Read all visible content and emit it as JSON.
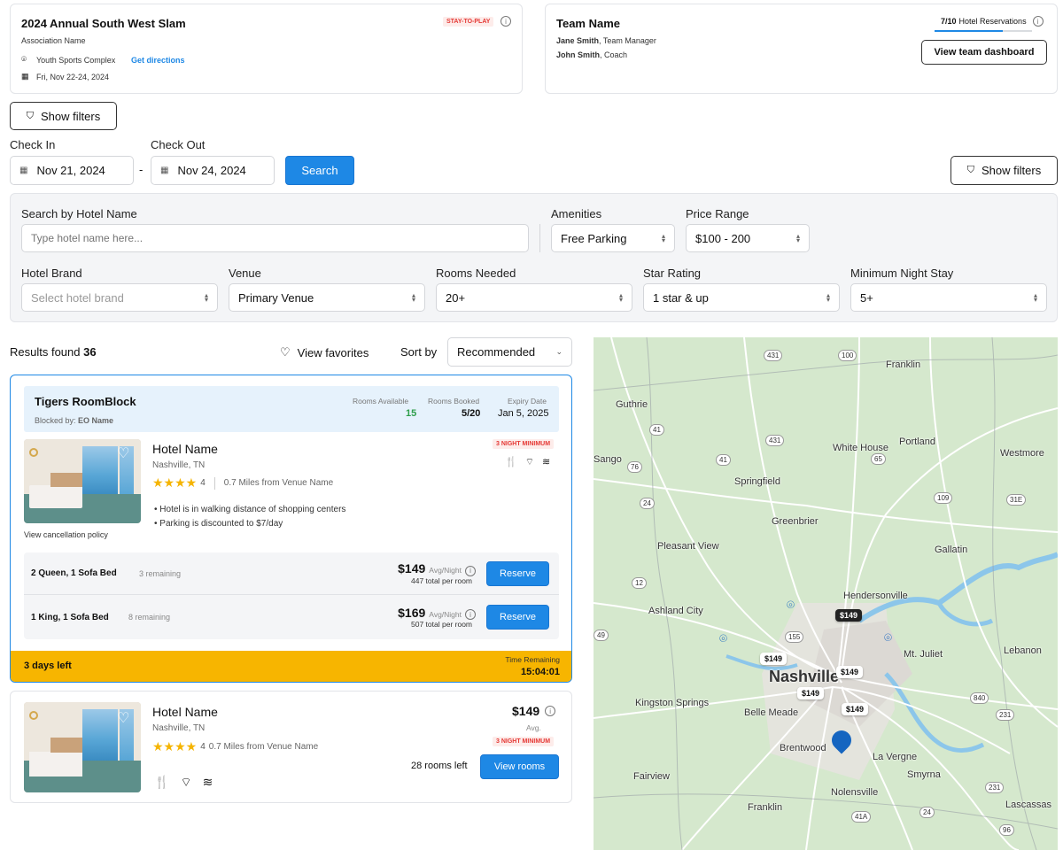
{
  "event": {
    "title": "2024 Annual South West Slam",
    "association": "Association Name",
    "badge": "STAY-TO-PLAY",
    "venue": "Youth Sports Complex",
    "directions": "Get directions",
    "dates": "Fri, Nov 22-24, 2024"
  },
  "team": {
    "title": "Team Name",
    "manager_name": "Jane Smith",
    "manager_role": ", Team Manager",
    "coach_name": "John Smith",
    "coach_role": ", Coach",
    "reservations_count": "7/10",
    "reservations_label": "Hotel Reservations",
    "reservations_progress": 0.7,
    "dashboard_button": "View team dashboard"
  },
  "show_filters": "Show filters",
  "dates": {
    "checkin_label": "Check In",
    "checkin_value": "Nov 21, 2024",
    "checkout_label": "Check Out",
    "checkout_value": "Nov 24, 2024",
    "separator": "-",
    "search": "Search"
  },
  "filters": {
    "hotel_name_label": "Search by Hotel Name",
    "hotel_name_placeholder": "Type hotel name here...",
    "amenities_label": "Amenities",
    "amenities_value": "Free Parking",
    "price_label": "Price Range",
    "price_value": "$100 - 200",
    "brand_label": "Hotel Brand",
    "brand_placeholder": "Select hotel brand",
    "venue_label": "Venue",
    "venue_value": "Primary Venue",
    "rooms_label": "Rooms Needed",
    "rooms_value": "20+",
    "star_label": "Star Rating",
    "star_value": "1 star & up",
    "night_label": "Minimum Night Stay",
    "night_value": "5+"
  },
  "results": {
    "label": "Results found",
    "count": "36",
    "favorites": "View favorites",
    "sort_label": "Sort by",
    "sort_value": "Recommended"
  },
  "roomblock": {
    "title": "Tigers RoomBlock",
    "blocked_label": "Blocked by:",
    "blocked_value": "EO Name",
    "avail_label": "Rooms Available",
    "avail_value": "15",
    "booked_label": "Rooms Booked",
    "booked_value": "5/20",
    "expiry_label": "Expiry Date",
    "expiry_value": "Jan 5, 2025",
    "hotel_name": "Hotel Name",
    "location": "Nashville, TN",
    "rating": "4",
    "distance": "0.7 Miles from Venue Name",
    "min_badge": "3 NIGHT MINIMUM",
    "bullet1": "Hotel is in walking distance of shopping centers",
    "bullet2": "Parking is discounted to $7/day",
    "cancel": "View cancellation policy",
    "rooms": [
      {
        "type": "2 Queen, 1 Sofa Bed",
        "remaining": "3 remaining",
        "price": "$149",
        "avg": "Avg/Night",
        "total": "447 total per room",
        "button": "Reserve"
      },
      {
        "type": "1 King, 1 Sofa Bed",
        "remaining": "8 remaining",
        "price": "$169",
        "avg": "Avg/Night",
        "total": "507 total per room",
        "button": "Reserve"
      }
    ],
    "days_left": "3 days left",
    "time_label": "Time Remaining",
    "time_value": "15:04:01"
  },
  "hotel2": {
    "name": "Hotel Name",
    "location": "Nashville, TN",
    "rating": "4",
    "distance": "0.7 Miles from Venue Name",
    "price": "$149",
    "avg": "Avg.",
    "min_badge": "3 NIGHT MINIMUM",
    "rooms_left": "28 rooms left",
    "button": "View rooms"
  },
  "map": {
    "labels": [
      "Franklin",
      "Guthrie",
      "Portland",
      "Westmore",
      "Sango",
      "Springfield",
      "White House",
      "Greenbrier",
      "Pleasant View",
      "Gallatin",
      "Hendersonville",
      "Ashland City",
      "Mt. Juliet",
      "Lebanon",
      "Nashville",
      "Kingston Springs",
      "Belle Meade",
      "Brentwood",
      "La Vergne",
      "Fairview",
      "Smyrna",
      "Nolensville",
      "Franklin",
      "Lascassas"
    ],
    "route_numbers": [
      "431",
      "100",
      "41",
      "431",
      "76",
      "41",
      "65",
      "24",
      "109",
      "31E",
      "12",
      "155",
      "840",
      "231",
      "231",
      "24",
      "41A",
      "96",
      "49"
    ],
    "price_tags": [
      "$149",
      "$149",
      "$149",
      "$149",
      "$149"
    ]
  }
}
